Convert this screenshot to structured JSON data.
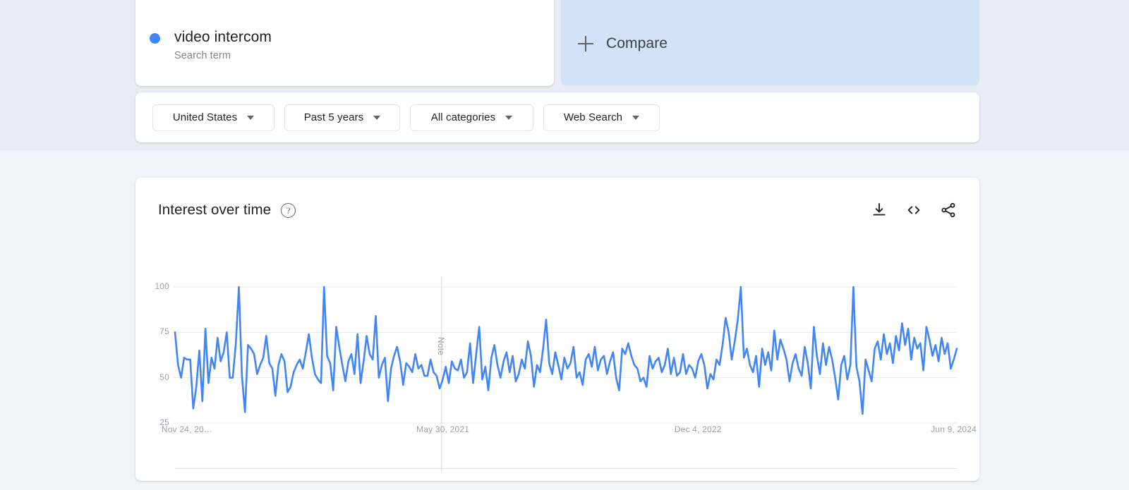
{
  "search_term_card": {
    "term": "video intercom",
    "subtitle": "Search term",
    "dot_color": "#4285f4"
  },
  "compare_card": {
    "label": "Compare",
    "plus_icon": "plus-icon",
    "background": "#d2e3f8"
  },
  "filters": [
    {
      "label": "United States",
      "icon": "chevron-down-icon"
    },
    {
      "label": "Past 5 years",
      "icon": "chevron-down-icon"
    },
    {
      "label": "All categories",
      "icon": "chevron-down-icon"
    },
    {
      "label": "Web Search",
      "icon": "chevron-down-icon"
    }
  ],
  "chart_card": {
    "title": "Interest over time",
    "help_icon": "help-circle-icon",
    "help_glyph": "?",
    "actions": [
      {
        "name": "download-icon",
        "label": "Download"
      },
      {
        "name": "embed-code-icon",
        "label": "Embed"
      },
      {
        "name": "share-icon",
        "label": "Share"
      }
    ]
  },
  "chart_data": {
    "type": "line",
    "title": "Interest over time",
    "xlabel": "",
    "ylabel": "",
    "ylim": [
      0,
      100
    ],
    "yticks": [
      100,
      75,
      50,
      25
    ],
    "grid": true,
    "legend": "none",
    "line_color": "#4285f4",
    "xtick_labels": [
      "Nov 24, 20…",
      "May 30, 2021",
      "Dec 4, 2022",
      "Jun 9, 2024"
    ],
    "xtick_positions": [
      0.008,
      0.334,
      0.664,
      0.992
    ],
    "annotation": {
      "label": "Note",
      "x_fraction": 0.341,
      "orientation": "vertical"
    },
    "series": [
      {
        "name": "video intercom",
        "color": "#4285f4",
        "values": [
          75,
          57,
          50,
          61,
          60,
          60,
          33,
          45,
          65,
          37,
          77,
          47,
          61,
          55,
          72,
          59,
          64,
          75,
          50,
          50,
          69,
          100,
          51,
          31,
          68,
          66,
          63,
          52,
          57,
          61,
          73,
          58,
          55,
          40,
          57,
          63,
          59,
          42,
          45,
          53,
          57,
          60,
          55,
          64,
          74,
          61,
          52,
          49,
          47,
          100,
          62,
          58,
          43,
          78,
          67,
          57,
          48,
          59,
          63,
          52,
          74,
          47,
          59,
          73,
          63,
          60,
          84,
          50,
          57,
          61,
          37,
          55,
          62,
          67,
          59,
          46,
          58,
          56,
          53,
          63,
          55,
          57,
          51,
          51,
          60,
          53,
          51,
          44,
          49,
          56,
          47,
          59,
          55,
          54,
          60,
          50,
          53,
          69,
          47,
          63,
          78,
          49,
          56,
          43,
          61,
          68,
          57,
          50,
          59,
          64,
          53,
          62,
          48,
          52,
          60,
          55,
          70,
          62,
          45,
          57,
          53,
          66,
          82,
          58,
          52,
          64,
          57,
          49,
          61,
          55,
          58,
          67,
          50,
          53,
          46,
          60,
          63,
          56,
          67,
          54,
          60,
          62,
          52,
          59,
          64,
          50,
          43,
          66,
          63,
          69,
          62,
          57,
          55,
          48,
          50,
          45,
          62,
          55,
          59,
          61,
          53,
          57,
          66,
          52,
          61,
          51,
          53,
          63,
          52,
          57,
          55,
          50,
          59,
          63,
          57,
          44,
          52,
          49,
          60,
          57,
          68,
          83,
          75,
          60,
          70,
          82,
          100,
          61,
          66,
          57,
          53,
          62,
          45,
          66,
          57,
          64,
          54,
          76,
          60,
          71,
          66,
          60,
          48,
          58,
          63,
          55,
          51,
          67,
          58,
          44,
          78,
          62,
          52,
          69,
          57,
          67,
          60,
          50,
          38,
          57,
          62,
          49,
          57,
          100,
          56,
          48,
          30,
          60,
          54,
          48,
          66,
          70,
          60,
          74,
          63,
          69,
          58,
          73,
          65,
          80,
          68,
          77,
          60,
          72,
          66,
          69,
          54,
          78,
          71,
          62,
          68,
          59,
          72,
          63,
          69,
          55,
          60,
          66
        ]
      }
    ]
  }
}
